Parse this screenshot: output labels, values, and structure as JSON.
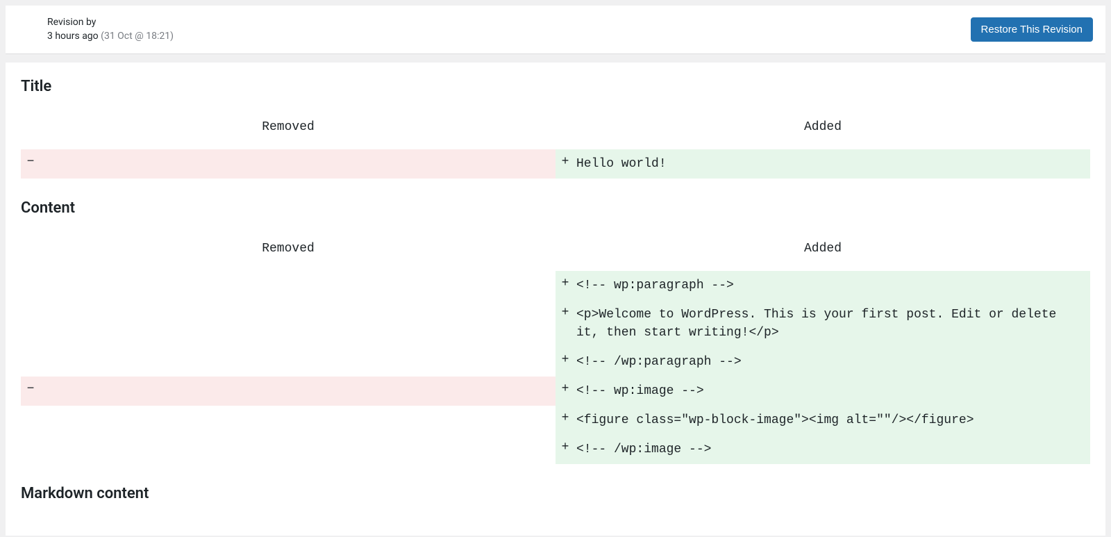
{
  "header": {
    "revision_by_label": "Revision by",
    "relative_time": "3 hours ago",
    "absolute_time": "(31 Oct @ 18:21)",
    "restore_button": "Restore This Revision"
  },
  "diff_labels": {
    "removed": "Removed",
    "added": "Added",
    "minus": "−",
    "plus": "+"
  },
  "sections": [
    {
      "heading": "Title",
      "rows": [
        {
          "removed": "",
          "added": "Hello world!"
        }
      ]
    },
    {
      "heading": "Content",
      "rows": [
        {
          "removed": null,
          "added": "<!-- wp:paragraph -->"
        },
        {
          "removed": null,
          "added": "<p>Welcome to WordPress. This is your first post. Edit or delete it, then start writing!</p>"
        },
        {
          "removed": null,
          "added": "<!-- /wp:paragraph -->"
        },
        {
          "removed": "",
          "added": "<!-- wp:image -->"
        },
        {
          "removed": null,
          "added": "<figure class=\"wp-block-image\"><img alt=\"\"/></figure>"
        },
        {
          "removed": null,
          "added": "<!-- /wp:image -->"
        }
      ]
    },
    {
      "heading": "Markdown content",
      "rows": []
    }
  ]
}
